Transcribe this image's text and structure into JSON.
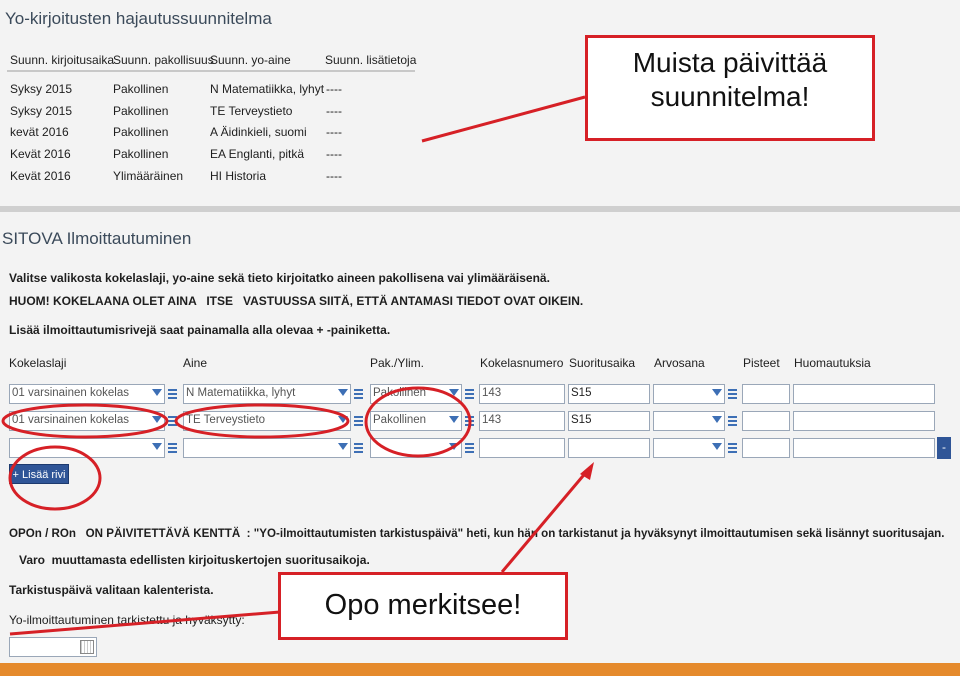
{
  "plan": {
    "title": "Yo-kirjoitusten hajautussuunnitelma",
    "headers": [
      "Suunn. kirjoitusaika",
      "Suunn. pakollisuus",
      "Suunn. yo-aine",
      "Suunn. lisätietoja"
    ],
    "rows": [
      [
        "Syksy 2015",
        "Pakollinen",
        "N Matematiikka, lyhyt",
        "----"
      ],
      [
        "Syksy 2015",
        "Pakollinen",
        "TE Terveystieto",
        "----"
      ],
      [
        "kevät 2016",
        "Pakollinen",
        "A Äidinkieli, suomi",
        "----"
      ],
      [
        "Kevät 2016",
        "Pakollinen",
        "EA Englanti, pitkä",
        "----"
      ],
      [
        "Kevät 2016",
        "Ylimääräinen",
        "HI Historia",
        "----"
      ]
    ]
  },
  "callout_top": {
    "line1": "Muista päivittää",
    "line2": "suunnitelma!"
  },
  "callout_bottom": {
    "text": "Opo merkitsee!"
  },
  "sitova": {
    "title": "SITOVA Ilmoittautuminen",
    "instr1": "Valitse valikosta kokelaslaji, yo-aine sekä tieto kirjoitatko aineen pakollisena vai ylimääräisenä.",
    "instr2": "HUOM! KOKELAANA OLET AINA   ITSE   VASTUUSSA SIITÄ, ETTÄ ANTAMASI TIEDOT OVAT OIKEIN.",
    "instr3": "Lisää ilmoittautumisrivejä saat painamalla alla olevaa + -painiketta.",
    "columns": [
      "Kokelaslaji",
      "Aine",
      "Pak./Ylim.",
      "Kokelasnumero",
      "Suoritusaika",
      "Arvosana",
      "Pisteet",
      "Huomautuksia"
    ],
    "rows": [
      {
        "kokelaslaji": "01 varsinainen kokelas",
        "aine": "N Matematiikka, lyhyt",
        "pak": "Pakollinen",
        "numero": "143",
        "aika": "S15"
      },
      {
        "kokelaslaji": "01 varsinainen kokelas",
        "aine": "TE Terveystieto",
        "pak": "Pakollinen",
        "numero": "143",
        "aika": "S15"
      },
      {
        "kokelaslaji": "",
        "aine": "",
        "pak": "",
        "numero": "",
        "aika": ""
      }
    ],
    "add_button": "+ Lisää rivi",
    "remove_button": "-",
    "note1": "OPOn / ROn   ON PÄIVITETTÄVÄ KENTTÄ  : \"YO-ilmoittautumisten tarkistuspäivä\" heti, kun hän on tarkistanut ja hyväksynyt ilmoittautumisen sekä lisännyt suoritusajan.",
    "note2": "Varo  muuttamasta edellisten kirjoituskertojen suoritusaikoja.",
    "note3": "Tarkistuspäivä valitaan kalenterista.",
    "check_label": "Yo-ilmoittautuminen tarkistettu ja hyväksytty:",
    "check_value": ""
  },
  "colors": {
    "annotation_red": "#d62026",
    "button_blue": "#2f5597",
    "bottom_bar": "#e58a2c"
  }
}
